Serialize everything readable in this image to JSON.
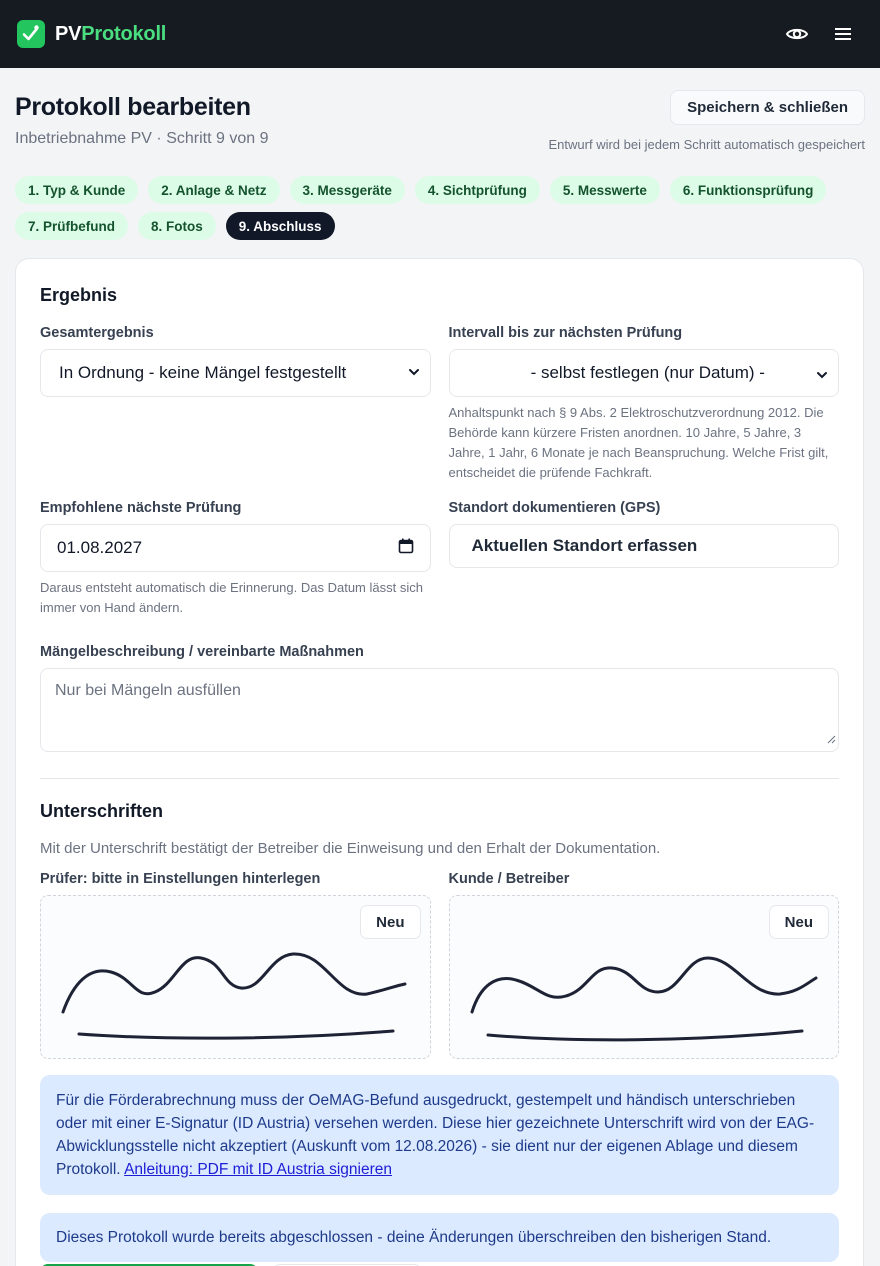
{
  "app": {
    "brand_prefix": "PV",
    "brand_suffix": "Protokoll"
  },
  "header": {
    "title": "Protokoll bearbeiten",
    "subtitle": "Inbetriebnahme PV · Schritt 9 von 9",
    "save_label": "Speichern & schließen",
    "autosave_note": "Entwurf wird bei jedem Schritt automatisch gespeichert"
  },
  "steps": [
    "1. Typ & Kunde",
    "2. Anlage & Netz",
    "3. Messgeräte",
    "4. Sichtprüfung",
    "5. Messwerte",
    "6. Funktionsprüfung",
    "7. Prüfbefund",
    "8. Fotos",
    "9. Abschluss"
  ],
  "result": {
    "section_title": "Ergebnis",
    "overall_label": "Gesamtergebnis",
    "overall_value": "In Ordnung - keine Mängel festgestellt",
    "interval_label": "Intervall bis zur nächsten Prüfung",
    "interval_value": "- selbst festlegen (nur Datum) -",
    "interval_hint": "Anhaltspunkt nach § 9 Abs. 2 Elektroschutzverordnung 2012. Die Behörde kann kürzere Fristen anordnen. 10 Jahre, 5 Jahre, 3 Jahre, 1 Jahr, 6 Monate je nach Beanspruchung. Welche Frist gilt, entscheidet die prüfende Fachkraft.",
    "next_label": "Empfohlene nächste Prüfung",
    "next_value": "01.08.2027",
    "next_hint": "Daraus entsteht automatisch die Erinnerung. Das Datum lässt sich immer von Hand ändern.",
    "gps_label": "Standort dokumentieren (GPS)",
    "gps_button": "Aktuellen Standort erfassen",
    "defects_label": "Mängelbeschreibung / vereinbarte Maßnahmen",
    "defects_placeholder": "Nur bei Mängeln ausfüllen"
  },
  "signatures": {
    "section_title": "Unterschriften",
    "intro": "Mit der Unterschrift bestätigt der Betreiber die Einweisung und den Erhalt der Dokumentation.",
    "inspector_label": "Prüfer: bitte in Einstellungen hinterlegen",
    "customer_label": "Kunde / Betreiber",
    "new_label": "Neu"
  },
  "notices": {
    "oemag_text": "Für die Förderabrechnung muss der OeMAG-Befund ausgedruckt, gestempelt und händisch unterschrieben oder mit einer E-Signatur (ID Austria) versehen werden. Diese hier gezeichnete Unterschrift wird von der EAG-Abwicklungsstelle nicht akzeptiert (Auskunft vom 12.08.2026) - sie dient nur der eigenen Ablage und diesem Protokoll.",
    "oemag_link": "Anleitung: PDF mit ID Austria signieren",
    "closed_text": "Dieses Protokoll wurde bereits abgeschlossen - deine Änderungen überschreiben den bisherigen Stand."
  },
  "colors": {
    "brand": "#22c55e",
    "step_bg": "#dcfce7",
    "notice_bg": "#dbeafe",
    "topbar": "#161a21"
  },
  "icons": [
    "check-clipboard-icon",
    "eye-icon",
    "menu-icon",
    "chevron-down-icon",
    "calendar-icon"
  ]
}
